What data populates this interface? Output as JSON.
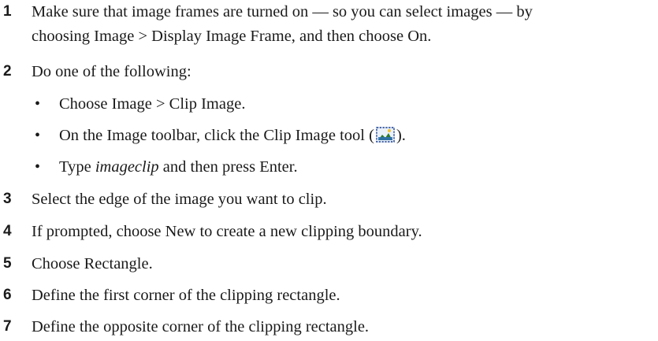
{
  "steps": [
    {
      "number": "1",
      "line1": "Make sure that image frames are turned on — so you can select images — by",
      "line2": "choosing Image > Display Image Frame, and then choose On."
    },
    {
      "number": "2",
      "text": "Do one of the following:",
      "bullets": [
        {
          "text": "Choose Image > Clip Image."
        },
        {
          "before": "On the Image toolbar, click the Clip Image tool (",
          "icon": "clip-image-tool-icon",
          "after": ")."
        },
        {
          "italic": "imageclip",
          "prefix": "Type ",
          "suffix": " and then press Enter."
        }
      ]
    },
    {
      "number": "3",
      "text": "Select the edge of the image you want to clip."
    },
    {
      "number": "4",
      "text": "If prompted, choose New to create a new clipping boundary."
    },
    {
      "number": "5",
      "text": "Choose Rectangle."
    },
    {
      "number": "6",
      "text": "Define the first corner of the clipping rectangle."
    },
    {
      "number": "7",
      "text": "Define the opposite corner of the clipping rectangle."
    }
  ],
  "bullet_glyph": "•"
}
